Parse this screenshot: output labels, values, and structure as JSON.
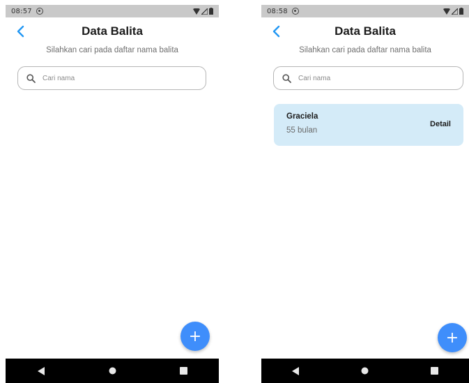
{
  "screens": [
    {
      "status": {
        "time": "08:57"
      },
      "header": {
        "title": "Data Balita",
        "subtitle": "Silahkan cari pada daftar nama balita"
      },
      "search": {
        "placeholder": "Cari nama",
        "value": ""
      },
      "items": []
    },
    {
      "status": {
        "time": "08:58"
      },
      "header": {
        "title": "Data Balita",
        "subtitle": "Silahkan cari pada daftar nama balita"
      },
      "search": {
        "placeholder": "Cari nama",
        "value": ""
      },
      "items": [
        {
          "name": "Graciela",
          "age": "55 bulan",
          "action_label": "Detail"
        }
      ]
    }
  ],
  "fab_label": "+",
  "colors": {
    "accent": "#3f8efb",
    "back_icon": "#2196f3",
    "card_bg": "#d4ebf8",
    "status_bar": "#c9c9c9",
    "nav_bar": "#000000"
  },
  "icons": {
    "back": "chevron-left-icon",
    "search": "search-icon",
    "add": "plus-icon",
    "nav": [
      "back-triangle-icon",
      "home-circle-icon",
      "recents-square-icon"
    ],
    "status": [
      "notification-icon",
      "wifi-icon",
      "signal-icon",
      "battery-icon"
    ]
  }
}
